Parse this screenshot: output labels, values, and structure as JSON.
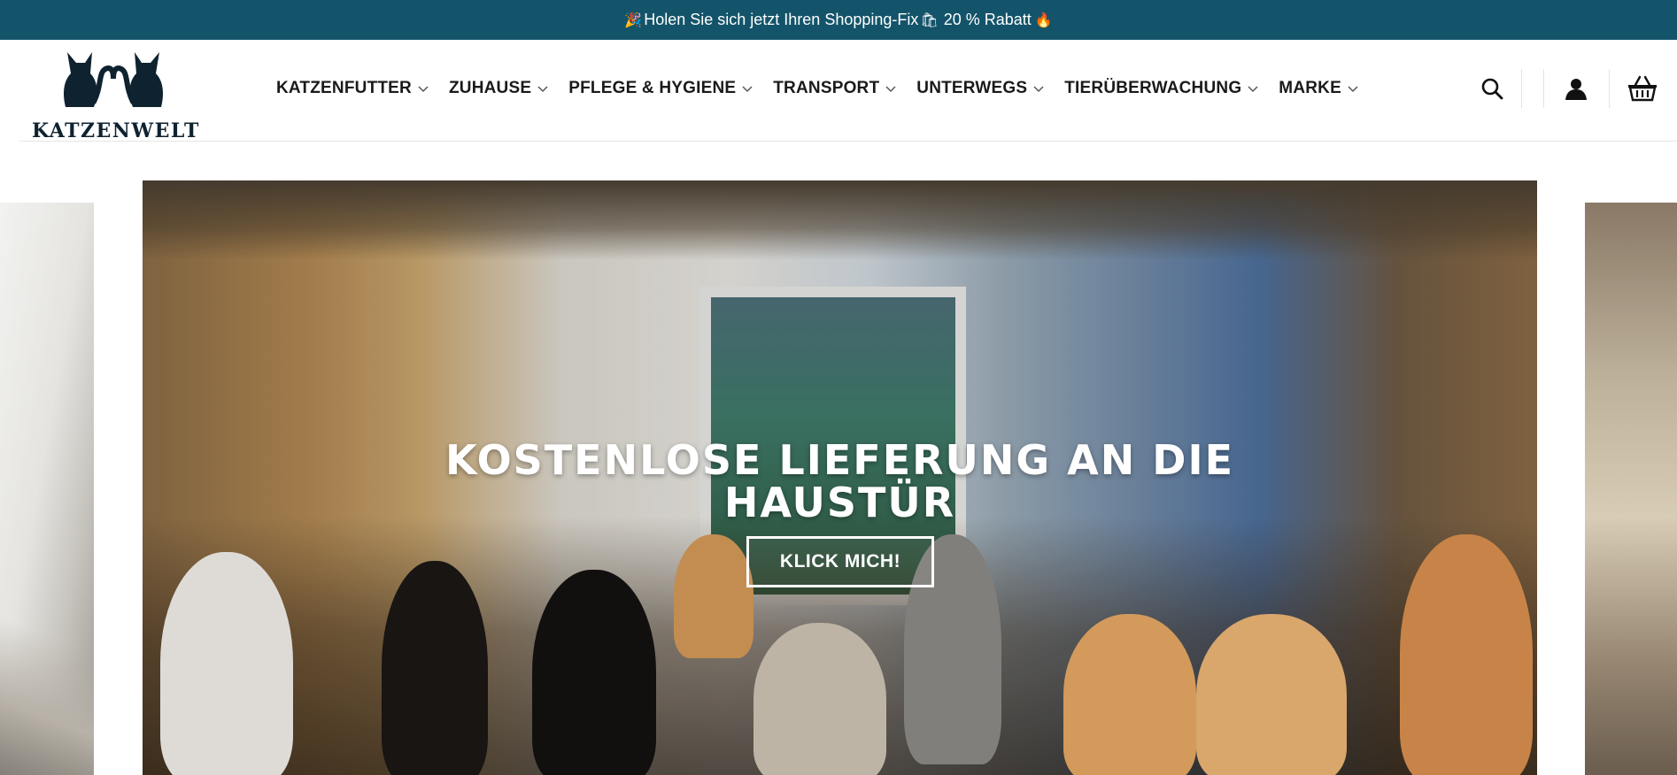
{
  "promo": {
    "text_before": "Holen Sie sich jetzt Ihren Shopping-Fix",
    "text_after": "20 % Rabatt",
    "icon_left": "🎉",
    "icon_bag": "🛍",
    "icon_fire": "🔥"
  },
  "brand": {
    "name": "KATZENWELT"
  },
  "nav": {
    "items": [
      {
        "label": "KATZENFUTTER"
      },
      {
        "label": "ZUHAUSE"
      },
      {
        "label": "PFLEGE & HYGIENE"
      },
      {
        "label": "TRANSPORT"
      },
      {
        "label": "UNTERWEGS"
      },
      {
        "label": "TIERÜBERWACHUNG"
      },
      {
        "label": "MARKE"
      }
    ]
  },
  "header_icons": [
    "search-icon",
    "user-icon",
    "basket-icon"
  ],
  "hero": {
    "title_line1": "KOSTENLOSE LIEFERUNG AN DIE",
    "title_line2": "HAUSTÜR",
    "button_label": "KLICK MICH!"
  },
  "colors": {
    "promo_bg": "#13546a",
    "text_dark": "#1a1a1a",
    "logo": "#0f2230"
  }
}
